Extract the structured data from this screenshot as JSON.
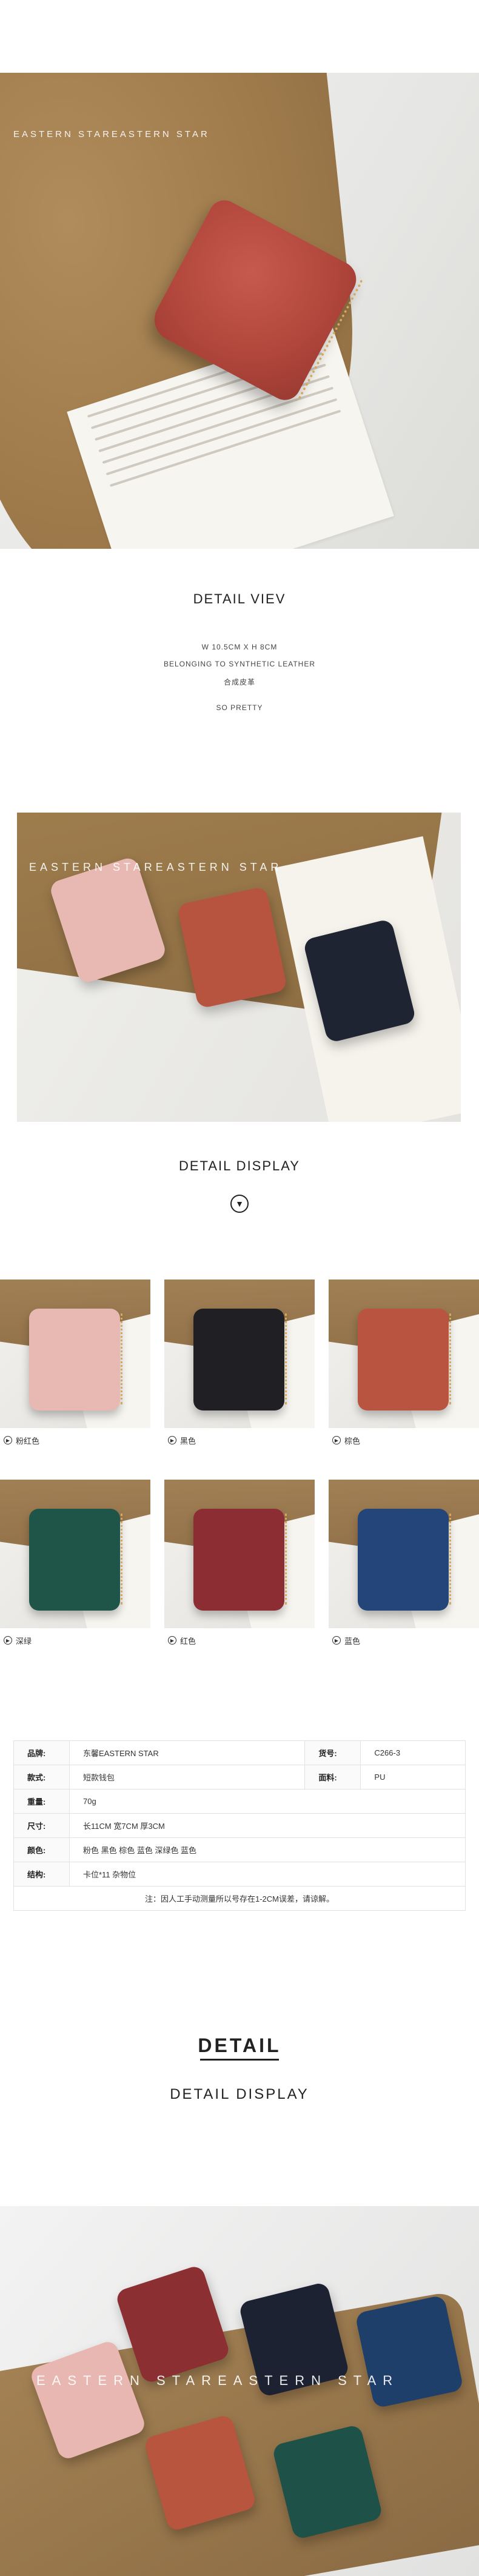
{
  "hero": {
    "brand": "EASTERN STAREASTERN STAR",
    "wallet_color": "#b1463c"
  },
  "detail_view": {
    "title": "DETAIL VIEV",
    "size": "W 10.5CM X H 8CM",
    "material_en": "BELONGING TO SYNTHETIC LEATHER",
    "material_cn": "合成皮革",
    "tagline": "SO PRETTY"
  },
  "group_photo": {
    "brand": "EASTERN STAREASTERN STAR"
  },
  "detail_display": {
    "title": "DETAIL DISPLAY",
    "chevron_icon": "chevron-down-circle-icon"
  },
  "colors": [
    {
      "label": "粉红色",
      "hex": "#e8b9b3"
    },
    {
      "label": "黑色",
      "hex": "#1f1f24"
    },
    {
      "label": "棕色",
      "hex": "#b8543f"
    },
    {
      "label": "深绿",
      "hex": "#1e5548"
    },
    {
      "label": "红色",
      "hex": "#8c2d33"
    },
    {
      "label": "蓝色",
      "hex": "#24457a"
    }
  ],
  "spec_table": {
    "brand_label": "品牌:",
    "brand_value": "东馨EASTERN STAR",
    "item_no_label": "货号:",
    "item_no_value": "C266-3",
    "style_label": "款式:",
    "style_value": "短款钱包",
    "fabric_label": "面料:",
    "fabric_value": "PU",
    "weight_label": "重量:",
    "weight_value": "70g",
    "size_label": "尺寸:",
    "size_value": "长11CM  宽7CM  厚3CM",
    "color_label": "颜色:",
    "color_value": "粉色 黑色 棕色 蓝色 深绿色 蓝色",
    "structure_label": "结构:",
    "structure_value": "卡位*11  杂物位",
    "note": "注：因人工手动测量所以号存在1-2CM误差，请谅解。"
  },
  "detail_block": {
    "title": "DETAIL",
    "subtitle": "DETAIL DISPLAY"
  },
  "bottom_photo": {
    "brand": "EASTERN STAREASTERN STAR"
  }
}
